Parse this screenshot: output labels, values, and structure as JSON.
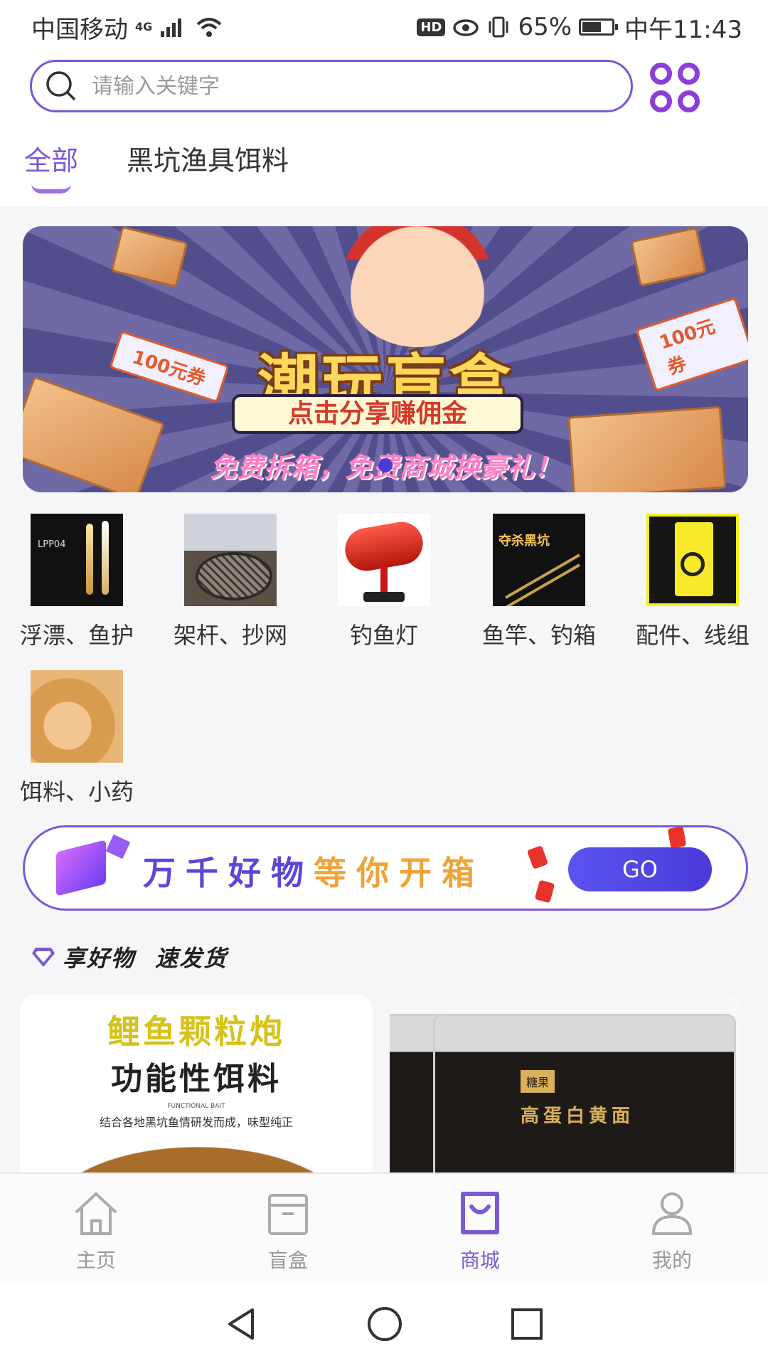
{
  "status_bar": {
    "carrier": "中国移动",
    "network": "4G",
    "battery_percent": "65%",
    "battery_level": 0.65,
    "time": "中午11:43",
    "hd_label": "HD"
  },
  "search": {
    "placeholder": "请输入关键字",
    "value": ""
  },
  "tabs": [
    {
      "label": "全部",
      "active": true
    },
    {
      "label": "黑坑渔具饵料",
      "active": false
    }
  ],
  "banner": {
    "title": "潮玩盲盒",
    "button": "点击分享赚佣金",
    "tagline": "免费拆箱，免费商城换豪礼！",
    "coupon_left": "100元券",
    "coupon_right": "100元券"
  },
  "categories": [
    {
      "label": "浮漂、鱼护",
      "thumb_text": "LPP04"
    },
    {
      "label": "架杆、抄网"
    },
    {
      "label": "钓鱼灯"
    },
    {
      "label": "鱼竿、钓箱",
      "thumb_text": "夺杀黑坑"
    },
    {
      "label": "配件、线组"
    },
    {
      "label": "饵料、小药"
    }
  ],
  "promo": {
    "slogan_part1": "万千好物",
    "slogan_part2": "等你开箱",
    "go_label": "GO"
  },
  "section": {
    "title": "享好物",
    "subtitle": "速发货"
  },
  "products": [
    {
      "headline": "鲤鱼颗粒炮",
      "subheadline": "功能性饵料",
      "english": "FUNCTIONAL BAIT",
      "description": "结合各地黑坑鱼情研发而成，味型纯正"
    },
    {
      "brand": "糖果",
      "label": "高蛋白黄面"
    }
  ],
  "bottom_nav": [
    {
      "label": "主页",
      "icon": "home-icon",
      "active": false
    },
    {
      "label": "盲盒",
      "icon": "box-icon",
      "active": false
    },
    {
      "label": "商城",
      "icon": "shopping-bag-icon",
      "active": true
    },
    {
      "label": "我的",
      "icon": "user-icon",
      "active": false
    }
  ],
  "colors": {
    "accent": "#7b58d6",
    "go_button": "#4a3ad8",
    "inactive_nav": "#999999"
  }
}
